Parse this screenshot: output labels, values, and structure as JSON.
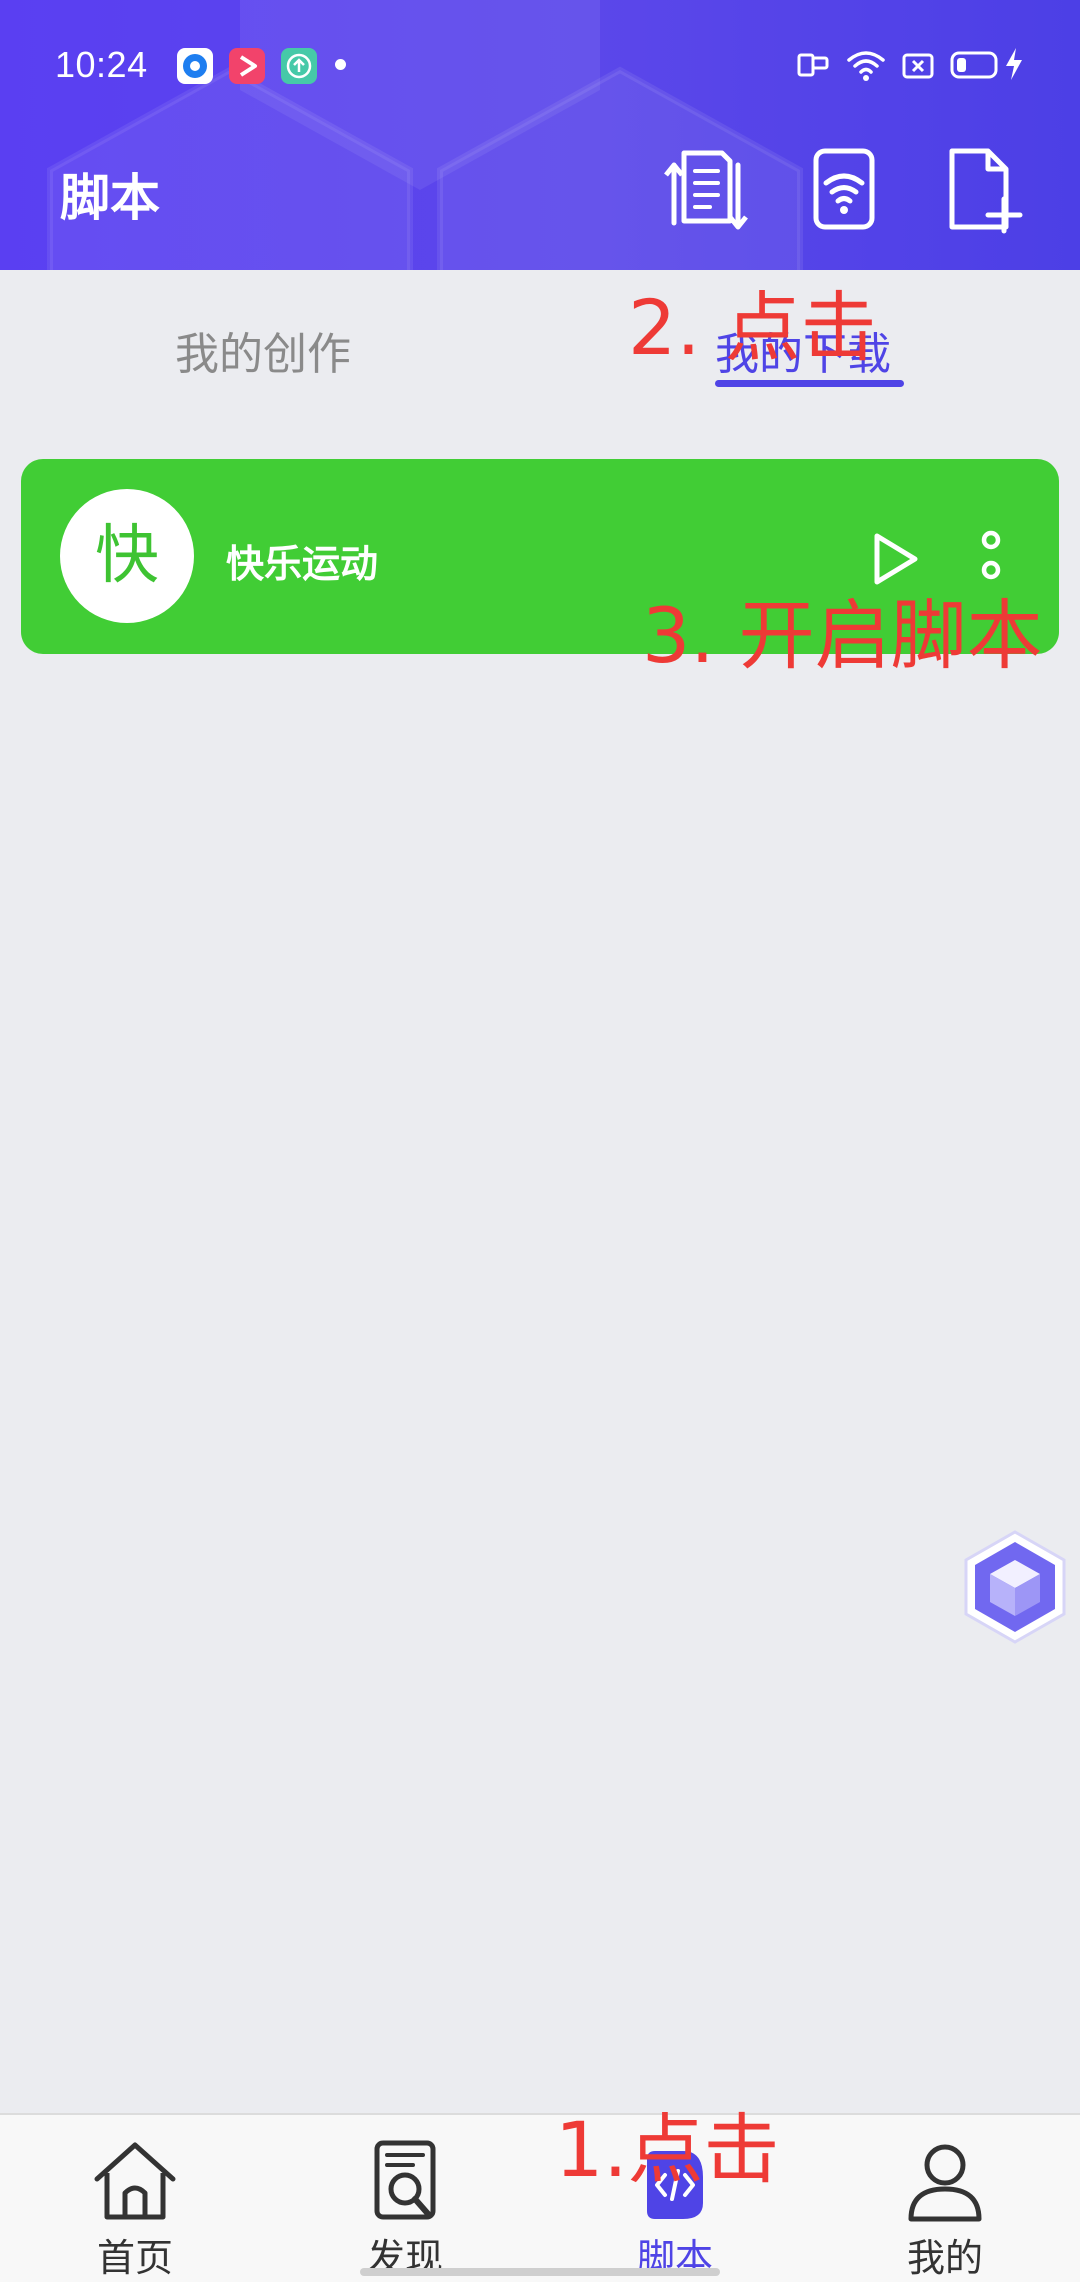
{
  "status_bar": {
    "time": "10:24",
    "app_icons": [
      "blue-target-app-icon",
      "red-play-app-icon",
      "teal-upload-app-icon"
    ],
    "right_icons": [
      "screen-cast-icon",
      "wifi-icon",
      "sim-card-icon",
      "battery-icon",
      "charging-icon"
    ]
  },
  "header": {
    "title": "脚本",
    "actions": [
      "sort-list-icon",
      "wifi-transfer-icon",
      "new-file-icon"
    ]
  },
  "tabs": {
    "creations": "我的创作",
    "downloads": "我的下载",
    "active": "downloads"
  },
  "scripts": [
    {
      "avatar_char": "快",
      "name": "快乐运动",
      "color": "#41cd35"
    }
  ],
  "annotations": {
    "step1": "1.点击",
    "step2": "2. 点击",
    "step3": "3. 开启脚本"
  },
  "bottom_nav": {
    "items": [
      {
        "label": "首页",
        "icon": "home-icon"
      },
      {
        "label": "发现",
        "icon": "discover-icon"
      },
      {
        "label": "脚本",
        "icon": "script-code-icon"
      },
      {
        "label": "我的",
        "icon": "profile-icon"
      }
    ],
    "active_index": 2
  },
  "colors": {
    "accent": "#4f44e6",
    "header_start": "#5a3ff2",
    "card_green": "#41cd35",
    "annotation_red": "#ee3a36",
    "background": "#ebecf0"
  }
}
